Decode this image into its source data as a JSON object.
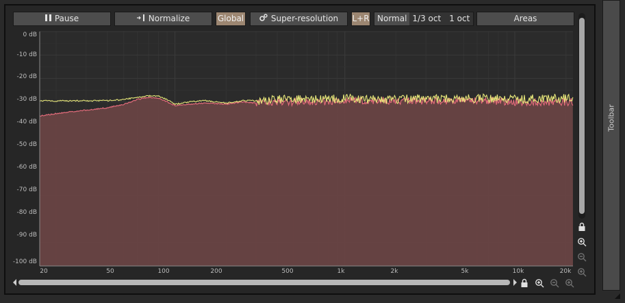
{
  "toolbar": {
    "pause_label": "Pause",
    "normalize_label": "Normalize",
    "global_label": "Global",
    "superres_label": "Super-resolution",
    "channel_label": "L+R",
    "normal_label": "Normal",
    "third_oct_label": "1/3 oct",
    "one_oct_label": "1 oct",
    "areas_label": "Areas"
  },
  "side_panel": {
    "label": "Toolbar"
  },
  "colors": {
    "fill": "#6a4444",
    "red_line": "#e26b7a",
    "yellow_line": "#e8e87a",
    "accent": "#9c8671"
  },
  "chart_data": {
    "type": "line",
    "x_scale": "log",
    "xlim": [
      16,
      22000
    ],
    "ylim": [
      -100,
      0
    ],
    "y_ticks": [
      "0 dB",
      "-10 dB",
      "-20 dB",
      "-30 dB",
      "-40 dB",
      "-50 dB",
      "-60 dB",
      "-70 dB",
      "-80 dB",
      "-90 dB",
      "-100 dB"
    ],
    "x_ticks": [
      "20",
      "50",
      "100",
      "200",
      "500",
      "1k",
      "2k",
      "5k",
      "10k",
      "20k"
    ],
    "series": [
      {
        "color": "red",
        "x": [
          16,
          20,
          30,
          40,
          50,
          60,
          70,
          80,
          90,
          100,
          120,
          150,
          200,
          250,
          300,
          400,
          500,
          700,
          1000,
          1500,
          2000,
          3000,
          5000,
          7000,
          10000,
          15000,
          20000,
          22000
        ],
        "y": [
          -36,
          -35,
          -33.5,
          -32.5,
          -31,
          -29,
          -28,
          -28.5,
          -30,
          -31.5,
          -31,
          -30.5,
          -31,
          -30,
          -30.5,
          -30,
          -30,
          -30,
          -29.5,
          -29.5,
          -29.5,
          -29.5,
          -29.5,
          -29.5,
          -30,
          -30,
          -30,
          -30
        ]
      },
      {
        "color": "yellow",
        "x": [
          16,
          20,
          30,
          40,
          50,
          60,
          70,
          80,
          90,
          100,
          120,
          150,
          200,
          250,
          300,
          400,
          500,
          700,
          1000,
          1500,
          2000,
          3000,
          5000,
          7000,
          10000,
          15000,
          20000,
          22000
        ],
        "y": [
          -29.5,
          -29.6,
          -29.5,
          -29.5,
          -29,
          -28,
          -27.5,
          -27.5,
          -29,
          -31,
          -30,
          -29.5,
          -30.5,
          -29.5,
          -29.5,
          -29,
          -29,
          -29,
          -28.5,
          -29,
          -29,
          -28.5,
          -28.5,
          -28.5,
          -29,
          -28.5,
          -28.5,
          -28.5
        ]
      }
    ]
  }
}
